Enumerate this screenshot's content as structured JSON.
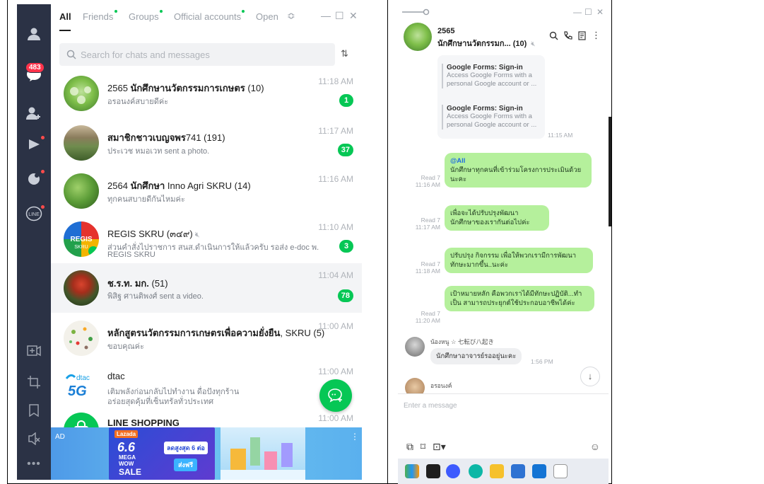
{
  "tabs": {
    "all": "All",
    "friends": "Friends",
    "groups": "Groups",
    "official": "Official accounts",
    "open": "Open"
  },
  "search": {
    "placeholder": "Search for chats and messages"
  },
  "rail": {
    "unread_badge": "483"
  },
  "chats": [
    {
      "name_prefix": "2565 ",
      "name_bold": "นักศึกษานวัตกรรมการเกษตร",
      "name_suffix": " (10)",
      "preview": "อรอนงค์สบายดีค่ะ",
      "time": "11:18 AM",
      "badge": "1"
    },
    {
      "name_prefix": "",
      "name_bold": "สมาชิกชาวเบญจพร",
      "name_suffix": "741 (191)",
      "preview": "ประเวช หมอเวท sent a photo.",
      "time": "11:17 AM",
      "badge": "37"
    },
    {
      "name_prefix": "2564 ",
      "name_bold": "นักศึกษา",
      "name_suffix": " Inno Agri SKRU (14)",
      "preview": "ทุกคนสบายดีกันไหมค่ะ",
      "time": "11:16 AM",
      "badge": ""
    },
    {
      "name_prefix": "REGIS SKRU (๓๔๙)",
      "name_bold": "",
      "name_suffix": "",
      "preview": "ส่วนคำสั่งไปราชการ สนส.ดำเนินการให้แล้วครับ รอส่ง e-doc พ...",
      "preview2": "REGIS SKRU",
      "time": "11:10 AM",
      "badge": "3"
    },
    {
      "name_prefix": "",
      "name_bold": "ช.ร.ท. มก.",
      "name_suffix": " (51)",
      "preview": "พิสิฐ ศานติพงศ์ sent a video.",
      "time": "11:04 AM",
      "badge": "78"
    },
    {
      "name_prefix": "",
      "name_bold": "หลักสูตรนวัตกรรมการเกษตรเพื่อความยั่งยืน",
      "name_suffix": ", SKRU (5)",
      "preview": "ขอบคุณค่ะ",
      "time": "11:00 AM",
      "badge": ""
    },
    {
      "name_prefix": "dtac",
      "name_bold": "",
      "name_suffix": "",
      "preview": "เติมพลังก่อนกลับไปทำงาน ดื่อปังทุกร้าน",
      "preview2": "อร่อยสุดคุ้มที่เซ็นทรัลทั่วประเทศ",
      "time": "11:00 AM",
      "badge": ""
    },
    {
      "name_prefix": "",
      "name_bold": "LINE SHOPPING",
      "name_suffix": "",
      "preview": "",
      "time": "11:00 AM",
      "badge": ""
    }
  ],
  "dtac_logo": {
    "brand": "dtac",
    "network": "5G"
  },
  "ad": {
    "label": "AD",
    "brand": "Lazada",
    "hero_line1": "6.6",
    "hero_line2": "MEGA",
    "hero_line3": "WOW",
    "hero_line4": "SALE",
    "promo1": "ลดสูงสุด 6 ต่อ",
    "promo2": "ส่งฟรี"
  },
  "room": {
    "title_line1": "2565",
    "title_line2": "นักศึกษานวัตกรรมก... (10)",
    "cards": [
      {
        "title": "Google Forms: Sign-in",
        "desc": "Access Google Forms with a personal Google account or ..."
      },
      {
        "title": "Google Forms: Sign-in",
        "desc": "Access Google Forms with a personal Google account or ..."
      }
    ],
    "card_time": "11:15 AM",
    "messages": [
      {
        "mention": "@All",
        "text": "นักศึกษาทุกคนที่เข้าร่วมโครงการประเมินด้วยนะคะ",
        "read": "Read 7",
        "time": "11:16 AM"
      },
      {
        "text": "เพื่อจะได้ปรับปรุงพัฒนา นักศึกษาของเรากันต่อไปค่ะ",
        "read": "Read 7",
        "time": "11:17 AM"
      },
      {
        "text": "ปรับปรุง กิจกรรม เพื่อให้พวกเรามีการพัฒนาทักษะมากขึ้น..นะค่ะ",
        "read": "Read 7",
        "time": "11:18 AM"
      },
      {
        "text": "เป้าหมายหลัก คือพวกเราได้มีทักษะปฏิบัติ...ทำเป็น สามารถประยุกต์ใช้ประกอบอาชีพได้ค่ะ",
        "read": "Read 7",
        "time": "11:20 AM"
      }
    ],
    "incoming": [
      {
        "sender": "น้องหนู ☆ 七転び八起き",
        "text": "นักศึกษาอาจารย์รออยู่นะคะ",
        "time": "1:56 PM"
      },
      {
        "sender": "อรอนงค์",
        "text": "",
        "time": ""
      }
    ],
    "input_placeholder": "Enter a message"
  },
  "colors": {
    "accent": "#06c755",
    "rail": "#2b3245",
    "bubble": "#b5f09c"
  }
}
